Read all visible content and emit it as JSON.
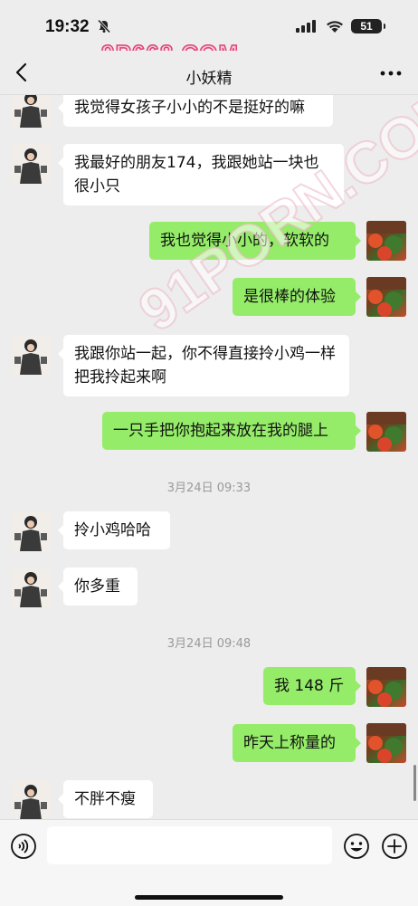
{
  "status_bar": {
    "time": "19:32",
    "battery": "51"
  },
  "watermarks": {
    "top": "9P668.COM",
    "diagonal": "91PORN.COM"
  },
  "header": {
    "title": "小妖精"
  },
  "messages": [
    {
      "side": "in",
      "text": "我觉得女孩子小小的不是挺好的嘛"
    },
    {
      "side": "in",
      "text": "我最好的朋友174，我跟她站一块也很小只"
    },
    {
      "side": "out",
      "text": "我也觉得小小的，软软的"
    },
    {
      "side": "out",
      "text": "是很棒的体验"
    },
    {
      "side": "in",
      "text": "我跟你站一起，你不得直接拎小鸡一样把我拎起来啊"
    },
    {
      "side": "out",
      "text": "一只手把你抱起来放在我的腿上"
    },
    {
      "side": "in",
      "text": "拎小鸡哈哈"
    },
    {
      "side": "in",
      "text": "你多重"
    },
    {
      "side": "out",
      "text": "我 148 斤"
    },
    {
      "side": "out",
      "text": "昨天上称量的"
    },
    {
      "side": "in",
      "text": "不胖不瘦"
    }
  ],
  "timestamps": [
    "3月24日 09:33",
    "3月24日 09:48"
  ],
  "colors": {
    "background": "#ededed",
    "bubble_out": "#95ec69",
    "bubble_in": "#ffffff"
  },
  "input_bar": {
    "value": ""
  }
}
